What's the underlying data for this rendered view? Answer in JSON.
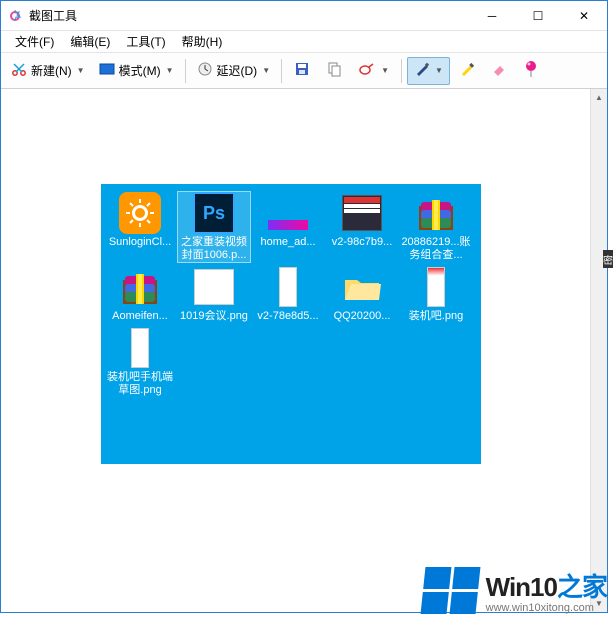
{
  "window": {
    "title": "截图工具",
    "buttons": {
      "min": "─",
      "max": "☐",
      "close": "✕"
    }
  },
  "menubar": {
    "items": [
      {
        "label": "文件(F)"
      },
      {
        "label": "编辑(E)"
      },
      {
        "label": "工具(T)"
      },
      {
        "label": "帮助(H)"
      }
    ]
  },
  "toolbar": {
    "new_label": "新建(N)",
    "mode_label": "模式(M)",
    "delay_label": "延迟(D)"
  },
  "capture": {
    "files": [
      {
        "name": "SunloginCl...",
        "icon": "sunlogin"
      },
      {
        "name": "之家重装视频封面1006.p...",
        "icon": "ps",
        "selected": true
      },
      {
        "name": "home_ad...",
        "icon": "img-purple"
      },
      {
        "name": "v2-98c7b9...",
        "icon": "img-dark"
      },
      {
        "name": "20886219...账务组合查...",
        "icon": "rar"
      },
      {
        "name": "Aomeifen...",
        "icon": "rar"
      },
      {
        "name": "1019会议.png",
        "icon": "img-white"
      },
      {
        "name": "v2-78e8d5...",
        "icon": "img-tall"
      },
      {
        "name": "QQ20200...",
        "icon": "folder"
      },
      {
        "name": "装机吧.png",
        "icon": "img-tall2"
      },
      {
        "name": "装机吧手机端草图.png",
        "icon": "img-tall"
      }
    ]
  },
  "watermark": {
    "text_en": "Win10",
    "text_zh": "之家",
    "url": "www.win10xitong.com"
  },
  "rightedge": "密"
}
